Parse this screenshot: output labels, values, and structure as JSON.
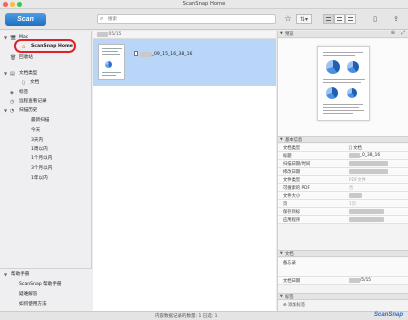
{
  "window": {
    "title": "ScanSnap Home"
  },
  "toolbar": {
    "scan_label": "Scan",
    "search_placeholder": "搜索",
    "star_icon": "star-icon",
    "sort_icon": "sort-icon"
  },
  "sidebar": {
    "items": [
      {
        "label": "Mac",
        "icon": "computer-icon",
        "level": 0
      },
      {
        "label": "ScanSnap Home",
        "icon": "home-icon",
        "level": 1
      },
      {
        "label": "回收站",
        "icon": "trash-icon",
        "level": 0
      },
      {
        "label": "文档类型",
        "icon": "doc-type-icon",
        "level": 0
      },
      {
        "label": "文档",
        "icon": "document-icon",
        "level": 1
      },
      {
        "label": "标签",
        "icon": "tag-icon",
        "level": 0
      },
      {
        "label": "远程查看记录",
        "icon": "history-icon",
        "level": 0
      },
      {
        "label": "扫描历史",
        "icon": "clock-icon",
        "level": 0
      },
      {
        "label": "最新扫描",
        "level": 1
      },
      {
        "label": "今天",
        "level": 1
      },
      {
        "label": "3天内",
        "level": 1
      },
      {
        "label": "1周以内",
        "level": 1
      },
      {
        "label": "1个月以内",
        "level": 1
      },
      {
        "label": "3个月以内",
        "level": 1
      },
      {
        "label": "1年以内",
        "level": 1
      }
    ],
    "help": {
      "header": "帮助手册",
      "items": [
        "ScanSnap 帮助手册",
        "疑难解答",
        "如何使用方法"
      ]
    }
  },
  "main": {
    "header": "05/15",
    "file": {
      "name": "_09_15_16_38_16"
    }
  },
  "right": {
    "preview_label": "预览",
    "basic_info_label": "基本信息",
    "props": [
      {
        "k": "文档类型",
        "v": "文档"
      },
      {
        "k": "标题",
        "v": "_0_38_16"
      },
      {
        "k": "扫描日期/时间",
        "v": ""
      },
      {
        "k": "修改日期",
        "v": ""
      },
      {
        "k": "文件类型",
        "v": "PDF文件"
      },
      {
        "k": "可搜索的 PDF",
        "v": "否"
      },
      {
        "k": "文件大小",
        "v": ""
      },
      {
        "k": "页",
        "v": "1页"
      },
      {
        "k": "保存目标",
        "v": ""
      },
      {
        "k": "应用程序",
        "v": ""
      }
    ],
    "doc_label": "文档",
    "doc_props": [
      {
        "k": "备忘录",
        "v": ""
      },
      {
        "k": "文档日期",
        "v": "/5/15"
      }
    ],
    "tags_label": "标签",
    "add_tag_label": "添加标签"
  },
  "status": {
    "text": "内容数据记录的数量: 1  已选: 1"
  },
  "brand": {
    "logo": "ScanSnap"
  },
  "colors": {
    "accent": "#2d6fc4",
    "selection": "#b9d6f8",
    "highlight_oval": "#e0202a"
  }
}
